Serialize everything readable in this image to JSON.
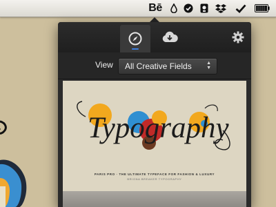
{
  "menubar": {
    "behance_label": "Bē",
    "icons": [
      "behance-icon",
      "drop-icon",
      "shield-check-icon",
      "app-icon",
      "dropbox-icon",
      "checkmark-icon",
      "battery-icon"
    ]
  },
  "toolbar": {
    "tabs": [
      {
        "name": "discover",
        "icon": "compass-icon",
        "active": true
      },
      {
        "name": "download",
        "icon": "cloud-download-icon",
        "active": false
      }
    ],
    "settings_icon": "gear-icon",
    "accent_color": "#3d7fe0"
  },
  "filter": {
    "view_label": "View",
    "selected": "All Creative Fields"
  },
  "project": {
    "title_art": "Typography",
    "tagline": "PARIS PRO · THE ULTIMATE TYPEFACE FOR FASHION & LUXURY",
    "subline": "BRIONA BREAKER TYPOGRAPHY"
  },
  "colors": {
    "desktop": "#cdbf9d",
    "panel": "#2a2a2a",
    "card": "#ddd6c2"
  }
}
